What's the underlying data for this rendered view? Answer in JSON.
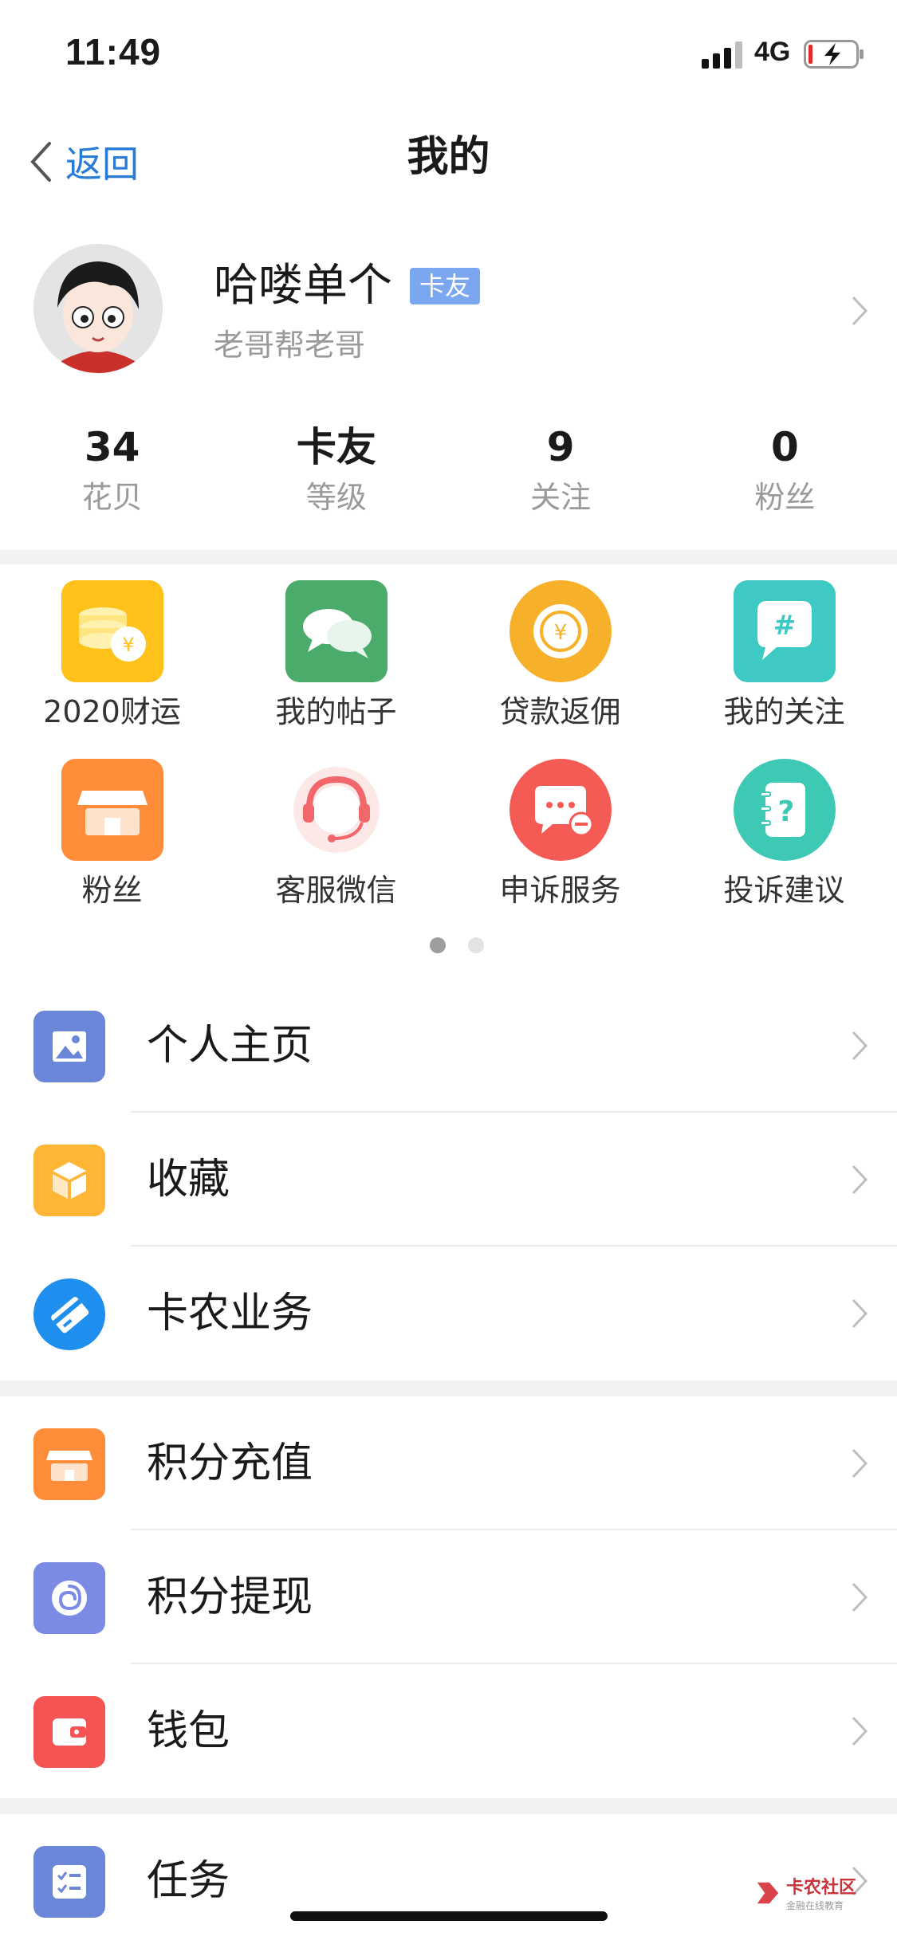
{
  "status_bar": {
    "time": "11:49",
    "network": "4G"
  },
  "nav": {
    "back_label": "返回",
    "title": "我的"
  },
  "profile": {
    "name": "哈喽单个",
    "tag": "卡友",
    "subtitle": "老哥帮老哥"
  },
  "stats": [
    {
      "value": "34",
      "label": "花贝"
    },
    {
      "value": "卡友",
      "label": "等级"
    },
    {
      "value": "9",
      "label": "关注"
    },
    {
      "value": "0",
      "label": "粉丝"
    }
  ],
  "grid": [
    {
      "label": "2020财运",
      "icon": "coins-icon",
      "color": "#ffc21a"
    },
    {
      "label": "我的帖子",
      "icon": "chat-bubbles-icon",
      "color": "#4aab6a"
    },
    {
      "label": "贷款返佣",
      "icon": "yuan-coin-icon",
      "color": "#f6b02a"
    },
    {
      "label": "我的关注",
      "icon": "hashtag-icon",
      "color": "#3ec9c4"
    },
    {
      "label": "粉丝",
      "icon": "store-icon",
      "color": "#ff8c38"
    },
    {
      "label": "客服微信",
      "icon": "headset-agent-icon",
      "color": "#f2676b"
    },
    {
      "label": "申诉服务",
      "icon": "message-minus-icon",
      "color": "#f45b54"
    },
    {
      "label": "投诉建议",
      "icon": "question-notebook-icon",
      "color": "#3ec9b4"
    }
  ],
  "pager": {
    "active": 0,
    "count": 2
  },
  "menu": [
    {
      "label": "个人主页",
      "icon": "picture-icon",
      "color": "#6a86d8"
    },
    {
      "label": "收藏",
      "icon": "box-icon",
      "color": "#ffb637"
    },
    {
      "label": "卡农业务",
      "icon": "card-icon",
      "color": "#1e8fee"
    },
    {
      "label": "积分充值",
      "icon": "store-icon",
      "color": "#ff8c38"
    },
    {
      "label": "积分提现",
      "icon": "swirl-icon",
      "color": "#7b8ae3"
    },
    {
      "label": "钱包",
      "icon": "wallet-icon",
      "color": "#f45454"
    },
    {
      "label": "任务",
      "icon": "checklist-icon",
      "color": "#6a86d8"
    }
  ],
  "watermark": {
    "title": "卡农社区",
    "subtitle": "金融在线教育"
  },
  "colors": {
    "accent": "#2a7bd6",
    "muted": "#9a9a9a",
    "separator": "#f2f2f2"
  }
}
